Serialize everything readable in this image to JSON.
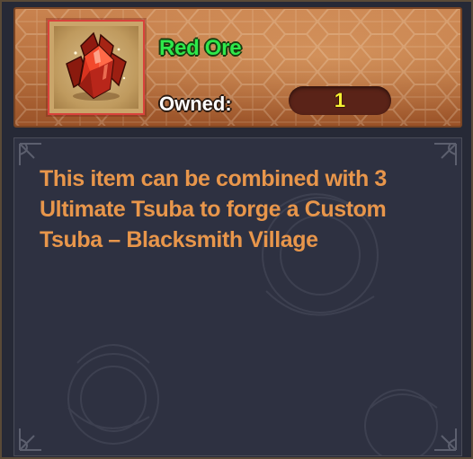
{
  "item": {
    "name": "Red Ore",
    "owned_label": "Owned:",
    "owned_value": "1",
    "icon": "red-crystal-icon",
    "description": "This item can be combined with 3 Ultimate Tsuba to forge a Custom Tsuba – Blacksmith Village"
  },
  "colors": {
    "name": "#2ee84a",
    "description": "#e8964b",
    "owned_value": "#f6f134",
    "header_bg": "#b56e3c",
    "body_bg": "#2e3141",
    "frame_border": "#d9433c"
  }
}
